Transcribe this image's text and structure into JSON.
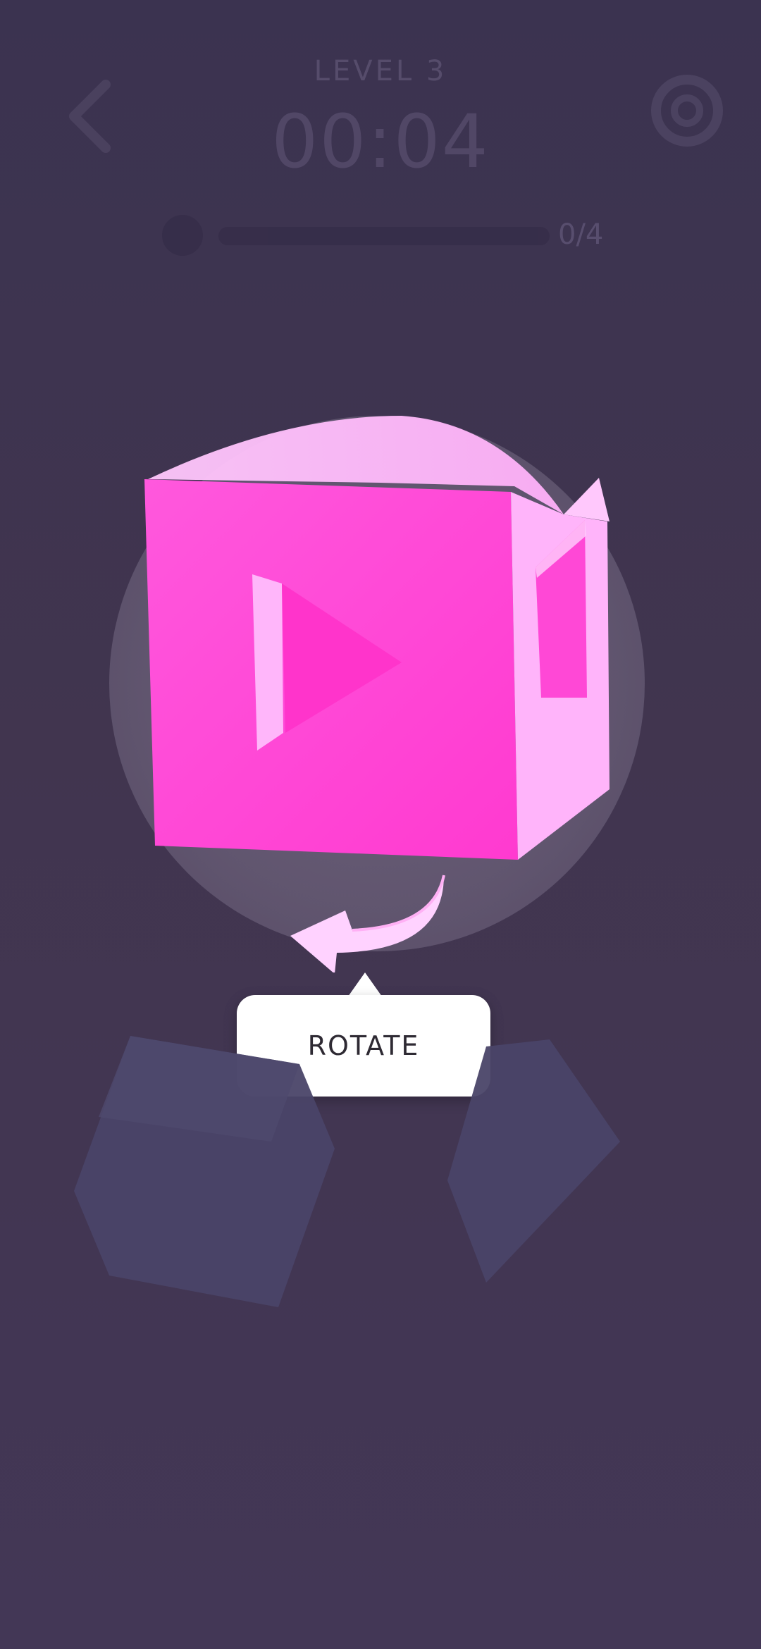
{
  "header": {
    "level_label": "LEVEL 3",
    "timer": "00:04",
    "progress_text": "0/4",
    "progress_fraction": 0.0
  },
  "tutorial": {
    "tooltip_label": "ROTATE",
    "arrow_icon": "rotate-arrow-icon"
  },
  "colors": {
    "background": "#3f3552",
    "cube_face": "#ff3fd4",
    "cube_light": "#ffb8fb",
    "tooltip_bg": "#ffffff",
    "ghost_cube": "#4a4468"
  }
}
